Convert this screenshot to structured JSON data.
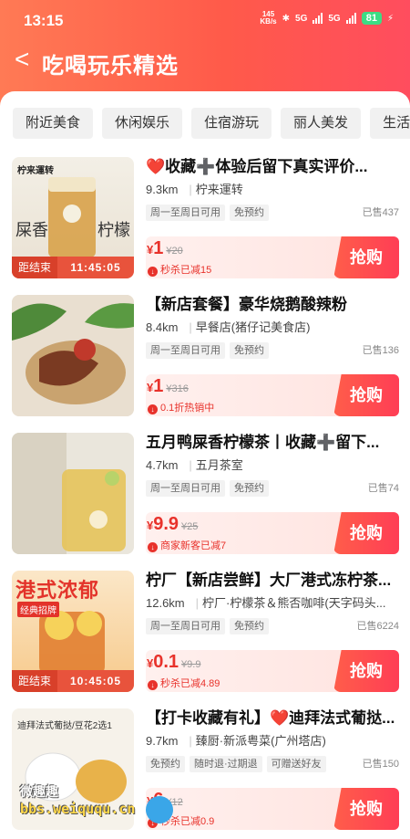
{
  "status_bar": {
    "time": "13:15",
    "net_speed": "145",
    "net_unit": "KB/s",
    "sim1": "5G",
    "sim2": "5G",
    "battery": "81"
  },
  "header": {
    "back_icon": "chevron-left-icon",
    "title": "吃喝玩乐精选"
  },
  "category_tabs": [
    "附近美食",
    "休闲娱乐",
    "住宿游玩",
    "丽人美发",
    "生活!"
  ],
  "deals": [
    {
      "title": "❤️收藏➕体验后留下真实评价...",
      "distance": "9.3km",
      "shop": "柠来運转",
      "tags": [
        "周一至周日可用",
        "免预约"
      ],
      "sold": "已售437",
      "price_symbol": "¥",
      "price": "1",
      "original_price": "¥20",
      "promo": "秒杀已减15",
      "buy_label": "抢购",
      "countdown_label": "距结束",
      "countdown": "11:45:05",
      "thumb_text": "柠来運转",
      "thumb_caption_left": "屎香",
      "thumb_caption_right": "柠檬"
    },
    {
      "title": "【新店套餐】豪华烧鹅酸辣粉",
      "distance": "8.4km",
      "shop": "早餐店(猪仔记美食店)",
      "tags": [
        "周一至周日可用",
        "免预约"
      ],
      "sold": "已售136",
      "price_symbol": "¥",
      "price": "1",
      "original_price": "¥316",
      "promo": "0.1折热销中",
      "buy_label": "抢购"
    },
    {
      "title": "五月鸭屎香柠檬茶丨收藏➕留下...",
      "distance": "4.7km",
      "shop": "五月茶室",
      "tags": [
        "周一至周日可用",
        "免预约"
      ],
      "sold": "已售74",
      "price_symbol": "¥",
      "price": "9.9",
      "original_price": "¥25",
      "promo": "商家新客已减7",
      "buy_label": "抢购"
    },
    {
      "title": "柠厂【新店尝鲜】大厂港式冻柠茶...",
      "distance": "12.6km",
      "shop": "柠厂·柠檬茶＆熊否咖啡(天字码头...",
      "tags": [
        "周一至周日可用",
        "免预约"
      ],
      "sold": "已售6224",
      "price_symbol": "¥",
      "price": "0.1",
      "original_price": "¥9.9",
      "promo": "秒杀已减4.89",
      "buy_label": "抢购",
      "countdown_label": "距结束",
      "countdown": "10:45:05",
      "thumb_text": "港式浓郁",
      "thumb_badge": "经典招牌"
    },
    {
      "title": "【打卡收藏有礼】❤️迪拜法式葡挞...",
      "distance": "9.7km",
      "shop": "臻厨·新派粤菜(广州塔店)",
      "tags": [
        "免预约",
        "随时退·过期退",
        "可赠送好友"
      ],
      "sold": "已售150",
      "price_symbol": "¥",
      "price": "6",
      "original_price": "¥12",
      "promo": "秒杀已减0.9",
      "buy_label": "抢购",
      "thumb_text": "迪拜法式葡挞/豆花2选1"
    }
  ],
  "watermark": {
    "line1": "微趣趣",
    "line2": "bbs.weiququ.cn"
  },
  "colors": {
    "accent": "#ff4d5e",
    "header_start": "#ff7a55",
    "price": "#e8322b"
  }
}
